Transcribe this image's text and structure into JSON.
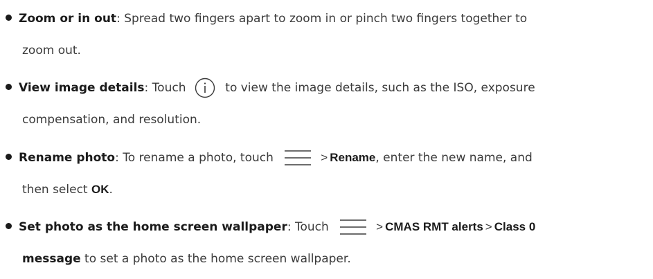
{
  "items": [
    {
      "term": "Zoom or in out",
      "line1": ": Spread two fingers apart to zoom in or pinch two fingers together to",
      "line2": "zoom out."
    },
    {
      "term": "View image details",
      "line1_pre": ": Touch ",
      "icon": "info-icon",
      "line1_post": " to view the image details, such as the ISO, exposure",
      "line2": "compensation, and resolution."
    },
    {
      "term": "Rename photo",
      "line1_pre": ": To rename a photo, touch ",
      "icon": "menu-icon",
      "sep": ">",
      "action": "Rename",
      "line1_post": ", enter the new name, and",
      "line2_pre": "then select ",
      "line2_bold": "OK",
      "line2_post": "."
    },
    {
      "term": "Set photo as the home screen wallpaper",
      "line1_pre": ": Touch ",
      "icon": "menu-icon",
      "sep1": ">",
      "action1": "CMAS RMT alerts",
      "sep2": ">",
      "action2": "Class 0",
      "line2_bold": "message",
      "line2_post": " to set a photo as the home screen wallpaper."
    }
  ],
  "colors": {
    "text": "#3b3b3b",
    "bold": "#1b1b1b"
  }
}
